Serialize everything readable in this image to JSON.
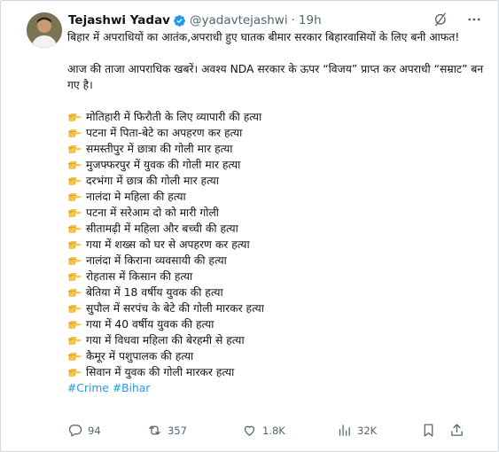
{
  "author": {
    "name": "Tejashwi Yadav",
    "handle": "@yadavtejashwi",
    "separator": "·",
    "time": "19h"
  },
  "post": {
    "intro_line": "बिहार में अपराधियों का आतंक,अपराधी हुए घातक बीमार सरकार बिहारवासियों के लिए बनी आफत!",
    "subtitle": "आज की ताजा आपराधिक खबरें। अवश्य NDA सरकार के ऊपर “विजय” प्राप्त कर अपराधी “सम्राट” बन गए है।",
    "items": [
      "मोतिहारी में फिरौती के लिए व्यापारी की हत्या",
      "पटना में पिता-बेटे का अपहरण कर हत्या",
      "समस्तीपुर में छात्रा की गोली मार हत्या",
      "मुजफ्फरपुर में युवक की गोली मार हत्या",
      "दरभंगा में छात्र की गोली मार हत्या",
      "नालंदा मे महिला की हत्या",
      "पटना में सरेआम दो को मारी गोली",
      "सीतामढ़ी में महिला और बच्ची की हत्या",
      "गया में शख्स को घर से अपहरण कर हत्या",
      "नालंदा में किराना व्यवसायी की हत्या",
      "रोहतास में किसान की हत्या",
      "बेतिया में 18 वर्षीय युवक की हत्या",
      "सुपौल में सरपंच के बेटे की गोली मारकर हत्या",
      "गया में 40 वर्षीय युवक की हत्या",
      "गया में विधवा महिला की बेरहमी से हत्या",
      "कैमूर में पशुपालक की हत्या",
      "सिवान में युवक की गोली मारकर हत्या"
    ],
    "hashtags": [
      "#Crime",
      "#Bihar"
    ]
  },
  "stats": {
    "replies": "94",
    "reposts": "357",
    "likes": "1.8K",
    "views": "32K"
  },
  "icons": {
    "bullet": "backhand-index-pointing-right-emoji",
    "verified": "verified-badge-icon",
    "grok": "grok-icon",
    "more": "more-options-icon",
    "reply": "reply-icon",
    "repost": "repost-icon",
    "like": "heart-icon",
    "views": "views-icon",
    "bookmark": "bookmark-icon",
    "share": "share-icon"
  },
  "colors": {
    "accent": "#1d9bf0",
    "text": "#0f1419",
    "muted": "#536471",
    "border": "#cfd9de"
  }
}
